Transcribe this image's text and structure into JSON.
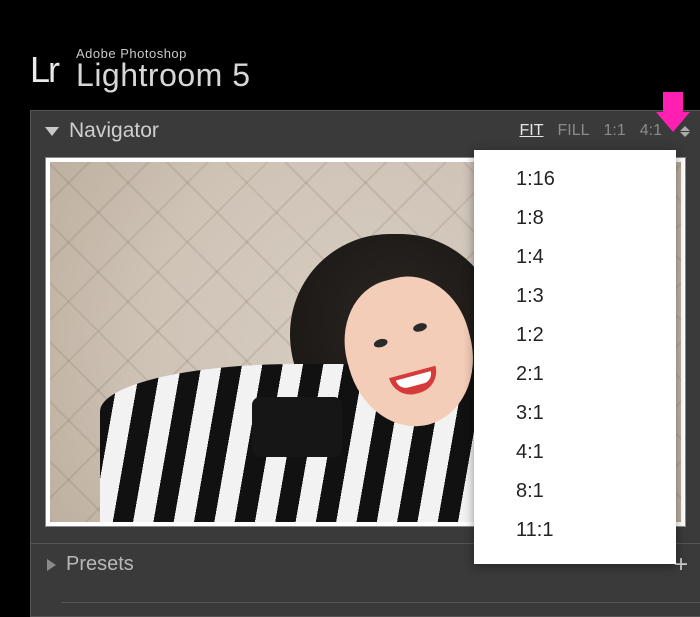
{
  "brand": {
    "logo": "Lr",
    "top": "Adobe Photoshop",
    "bottom": "Lightroom 5"
  },
  "navigator": {
    "title": "Navigator",
    "zoom": {
      "fit": "FIT",
      "fill": "FILL",
      "one_to_one": "1:1",
      "custom": "4:1"
    },
    "menu": [
      "1:16",
      "1:8",
      "1:4",
      "1:3",
      "1:2",
      "2:1",
      "3:1",
      "4:1",
      "8:1",
      "11:1"
    ]
  },
  "presets": {
    "title": "Presets",
    "add": "+"
  },
  "annotation": {
    "arrow_color": "#ff1fb0"
  }
}
